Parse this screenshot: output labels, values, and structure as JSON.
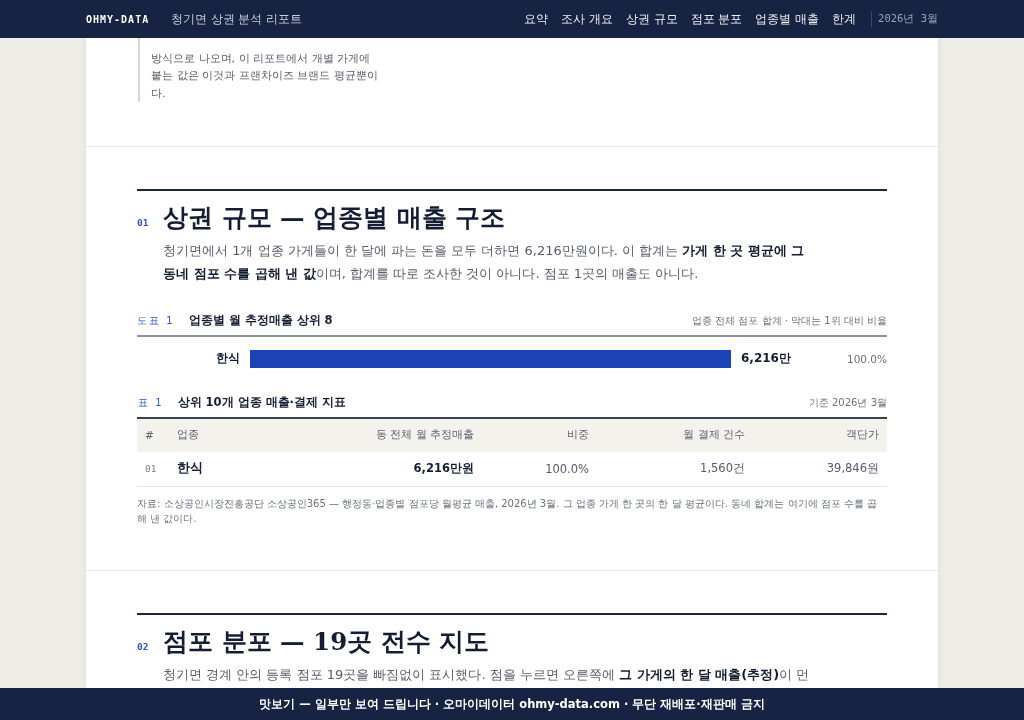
{
  "header": {
    "brand": "OHMY-DATA",
    "title": "청기면 상권 분석 리포트",
    "nav": [
      "요약",
      "조사 개요",
      "상권 규모",
      "점포 분포",
      "업종별 매출",
      "한계"
    ],
    "date": "2026년 3월"
  },
  "intro_quote": "방식으로 나오며, 이 리포트에서 개별 가게에 붙는 값은 이것과 프랜차이즈 브랜드 평균뿐이다.",
  "sections": [
    {
      "number": "01",
      "title": "상권 규모 — 업종별 매출 구조",
      "lead": "청기면에서 1개 업종 가게들이 한 달에 파는 돈을 모두 더하면 6,216만원이다. 이 합계는 **가게 한 곳 평균에 그 동네 점포 수를 곱해 낸 값**이며, 합계를 따로 조사한 것이 아니다. 점포 1곳의 매출도 아니다.",
      "figure": {
        "label": "도표 1",
        "title": "업종별 월 추정매출 상위 8",
        "note": "업종 전체 점포 합계 · 막대는 1위 대비 비율",
        "bars": [
          {
            "name": "한식",
            "level": 1,
            "value": "6,216만",
            "share": "100.0%"
          }
        ]
      },
      "table": {
        "label": "표 1",
        "title": "상위 10개 업종 매출·결제 지표",
        "note": "기준 2026년 3월",
        "columns": [
          "#",
          "업종",
          "동 전체 월 추정매출",
          "비중",
          "월 결제 건수",
          "객단가"
        ],
        "rows": [
          [
            "01",
            "한식",
            "6,216만원",
            "100.0%",
            "1,560건",
            "39,846원"
          ]
        ]
      },
      "source": "자료: 소상공인시장진흥공단 소상공인365 — 행정동·업종별 점포당 월평균 매출, 2026년 3월. 그 업종 가게 한 곳의 한 달 평균이다. 동네 합계는 여기에 점포 수를 곱해 낸 값이다."
    },
    {
      "number": "02",
      "title": "점포 분포 — 19곳 전수 지도",
      "lead": "청기면 경계 안의 등록 점포 19곳을 빠짐없이 표시했다. 점을 누르면 오른쪽에 **그 가게의 한 달 매출(추정)**이 먼"
    }
  ],
  "banner": "맛보기 — 일부만 보여 드립니다 · 오마이데이터 ohmy-data.com · 무단 재배포·재판매 금지"
}
